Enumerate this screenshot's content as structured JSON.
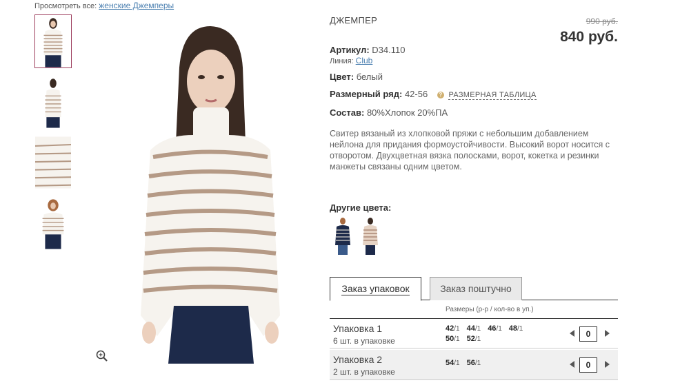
{
  "breadcrumb": {
    "prefix": "Просмотреть все:",
    "link": "женские Джемперы"
  },
  "product": {
    "type": "ДЖЕМПЕР",
    "old_price": "990 руб.",
    "price": "840 руб.",
    "article_label": "Артикул:",
    "article_value": "D34.110",
    "line_label": "Линия:",
    "line_value": "Club",
    "color_label": "Цвет:",
    "color_value": "белый",
    "size_label": "Размерный ряд:",
    "size_value": "42-56",
    "size_table_link": "РАЗМЕРНАЯ ТАБЛИЦА",
    "composition_label": "Состав:",
    "composition_value": "80%Хлопок 20%ПА",
    "description": "Свитер вязаный из хлопковой пряжи с небольшим добавлением нейлона для придания формоустойчивости. Высокий ворот носится с отворотом. Двухцветная вязка полосками, ворот, кокетка и резинки манжеты связаны одним цветом.",
    "other_colors_title": "Другие цвета:"
  },
  "tabs": {
    "active": "Заказ упаковок",
    "inactive": "Заказ поштучно"
  },
  "sizes_header": "Размеры (р-р / кол-во в уп.)",
  "packs": [
    {
      "name": "Упаковка 1",
      "count": "6 шт. в упаковке",
      "sizes": [
        {
          "size": "42",
          "qty": "/1"
        },
        {
          "size": "44",
          "qty": "/1"
        },
        {
          "size": "46",
          "qty": "/1"
        },
        {
          "size": "48",
          "qty": "/1"
        },
        {
          "size": "50",
          "qty": "/1"
        },
        {
          "size": "52",
          "qty": "/1"
        }
      ],
      "quantity": "0"
    },
    {
      "name": "Упаковка 2",
      "count": "2 шт. в упаковке",
      "sizes": [
        {
          "size": "54",
          "qty": "/1"
        },
        {
          "size": "56",
          "qty": "/1"
        }
      ],
      "quantity": "0"
    }
  ],
  "colors": {
    "stripe": "#b59a86",
    "sweater": "#f6f3ee",
    "navy": "#1d2a4a",
    "accent_border": "#9b3a5a",
    "link": "#4a7fb0"
  }
}
